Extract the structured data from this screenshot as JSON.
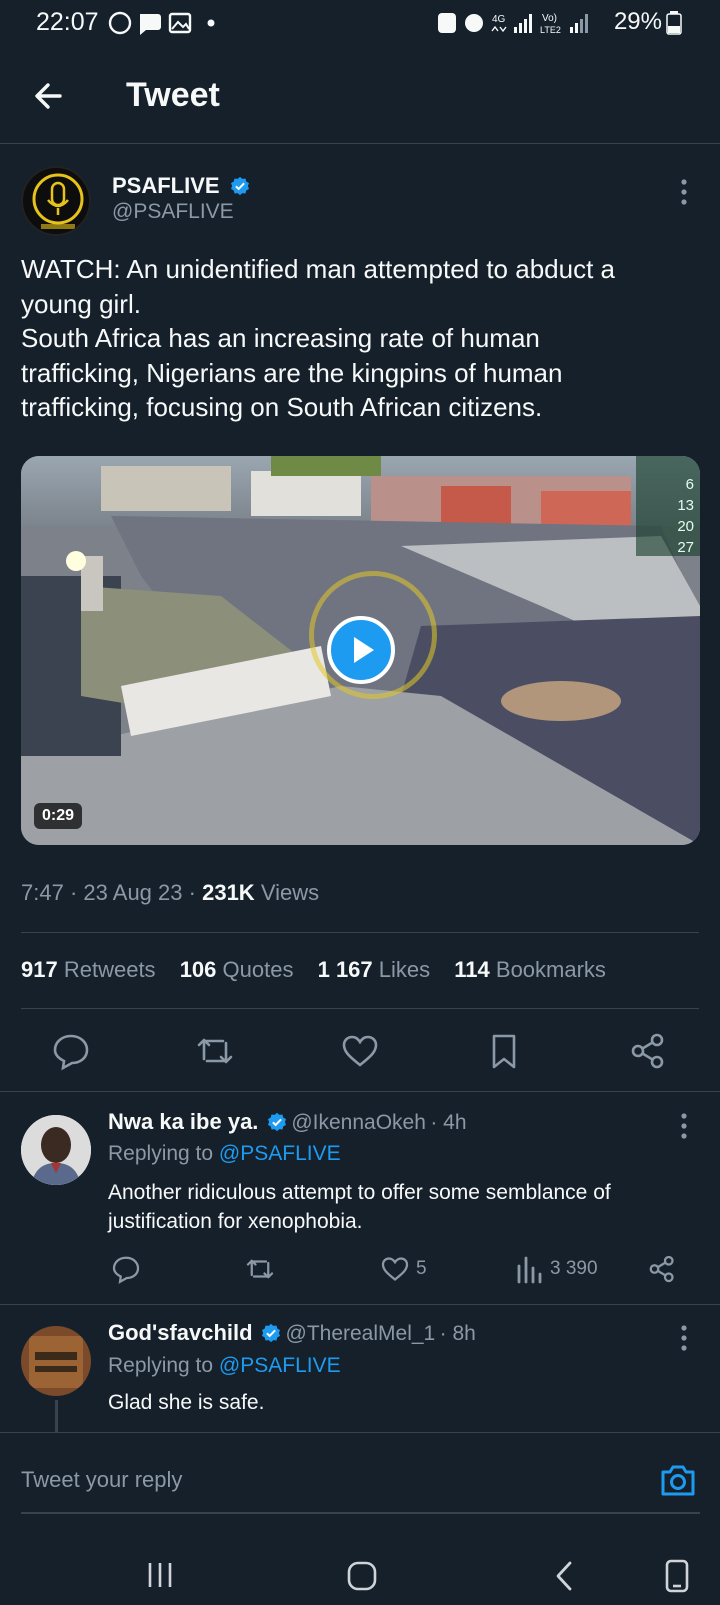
{
  "status_bar": {
    "time": "22:07",
    "network": "4G",
    "sim2": "Vo) LTE2",
    "battery": "29%",
    "icons": [
      "whatsapp-icon",
      "chat-icon",
      "gallery-icon",
      "dot-icon",
      "lock-icon",
      "alarm-icon",
      "signal-icon",
      "battery-icon"
    ]
  },
  "header": {
    "title": "Tweet",
    "back_icon": "arrow-left-icon"
  },
  "tweet": {
    "author_name": "PSAFLIVE",
    "author_handle": "@PSAFLIVE",
    "text_lines": [
      "WATCH: An unidentified man attempted to abduct a",
      "young girl.",
      "South Africa has an increasing rate of human",
      "trafficking, Nigerians are the kingpins of human",
      "trafficking, focusing on South African citizens."
    ],
    "video": {
      "duration": "0:29",
      "overlay_numbers": [
        "6",
        "13",
        "20",
        "27"
      ]
    },
    "time": "7:47",
    "date": "23 Aug 23",
    "views_count": "231K",
    "views_label": "Views",
    "sep": "·",
    "stats": {
      "retweets_count": "917",
      "retweets_label": "Retweets",
      "quotes_count": "106",
      "quotes_label": "Quotes",
      "likes_count": "1 167",
      "likes_label": "Likes",
      "bookmarks_count": "114",
      "bookmarks_label": "Bookmarks"
    }
  },
  "replies": [
    {
      "name": "Nwa ka ibe ya.",
      "handle": "@IkennaOkeh",
      "age": "· 4h",
      "replying_to_label": "Replying to",
      "replying_to": "@PSAFLIVE",
      "text_lines": [
        "Another ridiculous attempt to offer some semblance of",
        "justification for xenophobia."
      ],
      "likes": "5",
      "views": "3 390"
    },
    {
      "name": "God'sfavchild",
      "handle": "@TherealMel_1",
      "age": "· 8h",
      "replying_to_label": "Replying to",
      "replying_to": "@PSAFLIVE",
      "text_lines": [
        "Glad she is safe."
      ]
    }
  ],
  "composer": {
    "placeholder": "Tweet your reply"
  },
  "colors": {
    "background": "#15202b",
    "accent": "#1d9bf0",
    "muted": "#8b98a5",
    "divider": "#38444d"
  }
}
